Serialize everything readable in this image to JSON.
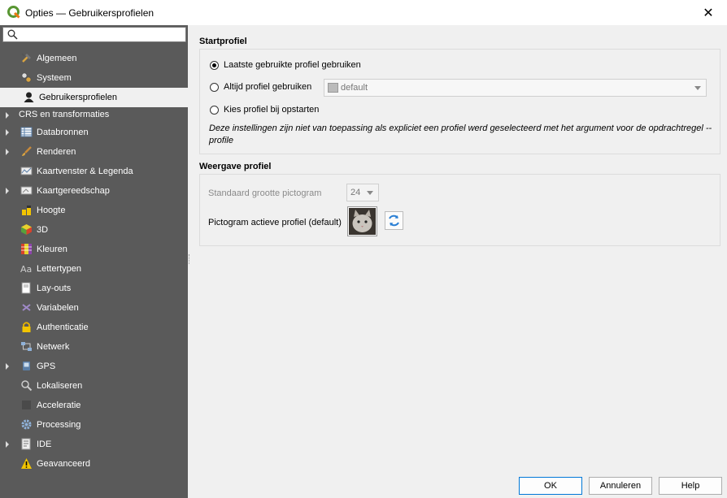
{
  "window": {
    "title": "Opties — Gebruikersprofielen",
    "close_glyph": "✕"
  },
  "sidebar": {
    "search_placeholder": "",
    "items": [
      {
        "label": "Algemeen",
        "icon": "hammer-icon",
        "expandable": false
      },
      {
        "label": "Systeem",
        "icon": "gears-icon",
        "expandable": false
      },
      {
        "label": "Gebruikersprofielen",
        "icon": "user-icon",
        "expandable": false,
        "selected": true
      },
      {
        "label": "CRS en transformaties",
        "icon": "",
        "expandable": true
      },
      {
        "label": "Databronnen",
        "icon": "table-icon",
        "expandable": true
      },
      {
        "label": "Renderen",
        "icon": "brush-icon",
        "expandable": true
      },
      {
        "label": "Kaartvenster & Legenda",
        "icon": "map-canvas-icon",
        "expandable": false
      },
      {
        "label": "Kaartgereedschap",
        "icon": "map-tools-icon",
        "expandable": true
      },
      {
        "label": "Hoogte",
        "icon": "elevation-icon",
        "expandable": false
      },
      {
        "label": "3D",
        "icon": "cube-icon",
        "expandable": false
      },
      {
        "label": "Kleuren",
        "icon": "colors-icon",
        "expandable": false
      },
      {
        "label": "Lettertypen",
        "icon": "font-icon",
        "expandable": false
      },
      {
        "label": "Lay-outs",
        "icon": "layout-icon",
        "expandable": false
      },
      {
        "label": "Variabelen",
        "icon": "variable-icon",
        "expandable": false
      },
      {
        "label": "Authenticatie",
        "icon": "lock-icon",
        "expandable": false
      },
      {
        "label": "Netwerk",
        "icon": "network-icon",
        "expandable": false
      },
      {
        "label": "GPS",
        "icon": "gps-icon",
        "expandable": true
      },
      {
        "label": "Lokaliseren",
        "icon": "locator-icon",
        "expandable": false
      },
      {
        "label": "Acceleratie",
        "icon": "chip-icon",
        "expandable": false
      },
      {
        "label": "Processing",
        "icon": "processing-gear-icon",
        "expandable": false
      },
      {
        "label": "IDE",
        "icon": "ide-icon",
        "expandable": true
      },
      {
        "label": "Geavanceerd",
        "icon": "warning-icon",
        "expandable": false
      }
    ]
  },
  "startprofiel": {
    "title": "Startprofiel",
    "option_last": "Laatste gebruikte profiel gebruiken",
    "option_always": "Altijd profiel gebruiken",
    "option_choose": "Kies profiel bij opstarten",
    "selected_option": "last",
    "profile_combo_value": "default",
    "note": "Deze instellingen zijn niet van toepassing als expliciet een profiel werd geselecteerd met het argument voor de opdrachtregel --profile"
  },
  "weergave": {
    "title": "Weergave profiel",
    "icon_size_label": "Standaard grootte pictogram",
    "icon_size_value": "24",
    "active_icon_label": "Pictogram actieve profiel (default)"
  },
  "buttons": {
    "ok": "OK",
    "cancel": "Annuleren",
    "help": "Help"
  },
  "colors": {
    "sidebar_bg": "#5a5a5a",
    "accent": "#0078d7",
    "qgis_green": "#589632"
  }
}
